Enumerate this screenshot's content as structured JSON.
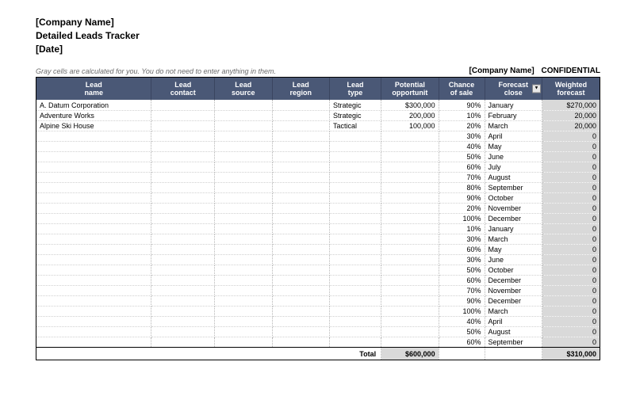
{
  "header": {
    "company": "[Company Name]",
    "title": "Detailed Leads Tracker",
    "date": "[Date]"
  },
  "note": "Gray cells are calculated for you. You do not need to enter anything in them.",
  "top_right_company": "[Company Name]",
  "top_right_confidential": "CONFIDENTIAL",
  "columns": {
    "name": "Lead\nname",
    "contact": "Lead\ncontact",
    "source": "Lead\nsource",
    "region": "Lead\nregion",
    "type": "Lead\ntype",
    "potential": "Potential\nopportunit",
    "chance": "Chance\nof sale",
    "forecast": "Forecast\nclose",
    "weighted": "Weighted\nforecast"
  },
  "rows": [
    {
      "name": "A. Datum Corporation",
      "type": "Strategic",
      "potential": "$300,000",
      "chance": "90%",
      "forecast": "January",
      "weighted": "$270,000"
    },
    {
      "name": "Adventure Works",
      "type": "Strategic",
      "potential": "200,000",
      "chance": "10%",
      "forecast": "February",
      "weighted": "20,000"
    },
    {
      "name": "Alpine Ski House",
      "type": "Tactical",
      "potential": "100,000",
      "chance": "20%",
      "forecast": "March",
      "weighted": "20,000"
    },
    {
      "chance": "30%",
      "forecast": "April",
      "weighted": "0"
    },
    {
      "chance": "40%",
      "forecast": "May",
      "weighted": "0"
    },
    {
      "chance": "50%",
      "forecast": "June",
      "weighted": "0"
    },
    {
      "chance": "60%",
      "forecast": "July",
      "weighted": "0"
    },
    {
      "chance": "70%",
      "forecast": "August",
      "weighted": "0"
    },
    {
      "chance": "80%",
      "forecast": "September",
      "weighted": "0"
    },
    {
      "chance": "90%",
      "forecast": "October",
      "weighted": "0"
    },
    {
      "chance": "20%",
      "forecast": "November",
      "weighted": "0"
    },
    {
      "chance": "100%",
      "forecast": "December",
      "weighted": "0"
    },
    {
      "chance": "10%",
      "forecast": "January",
      "weighted": "0"
    },
    {
      "chance": "30%",
      "forecast": "March",
      "weighted": "0"
    },
    {
      "chance": "60%",
      "forecast": "May",
      "weighted": "0"
    },
    {
      "chance": "30%",
      "forecast": "June",
      "weighted": "0"
    },
    {
      "chance": "50%",
      "forecast": "October",
      "weighted": "0"
    },
    {
      "chance": "60%",
      "forecast": "December",
      "weighted": "0"
    },
    {
      "chance": "70%",
      "forecast": "November",
      "weighted": "0"
    },
    {
      "chance": "90%",
      "forecast": "December",
      "weighted": "0"
    },
    {
      "chance": "100%",
      "forecast": "March",
      "weighted": "0"
    },
    {
      "chance": "40%",
      "forecast": "April",
      "weighted": "0"
    },
    {
      "chance": "50%",
      "forecast": "August",
      "weighted": "0"
    },
    {
      "chance": "60%",
      "forecast": "September",
      "weighted": "0"
    }
  ],
  "totals": {
    "label": "Total",
    "potential": "$600,000",
    "weighted": "$310,000"
  }
}
